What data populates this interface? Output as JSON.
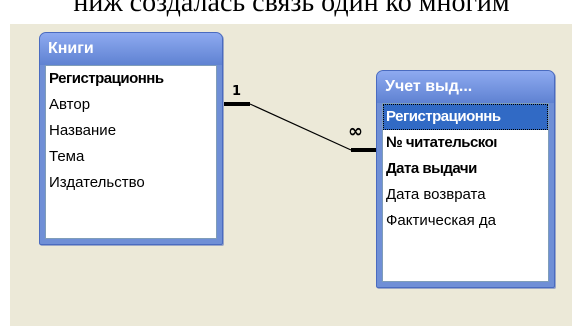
{
  "caption": "ниж создалась связь один ко многим",
  "tables": {
    "books": {
      "title": "Книги",
      "fields": [
        "Регистрационнь",
        "Автор",
        "Название",
        "Тема",
        "Издательство"
      ]
    },
    "issues": {
      "title": "Учет выд...",
      "fields": [
        "Регистрационнь",
        "№ читательскоı",
        "Дата выдачи",
        "Дата возврата",
        "Фактическая да"
      ]
    }
  },
  "relationship": {
    "one_label": "1",
    "many_label": "∞"
  },
  "colors": {
    "title_bar": "#6f8fd6",
    "selection": "#316ac5",
    "canvas": "#ece9d8"
  }
}
